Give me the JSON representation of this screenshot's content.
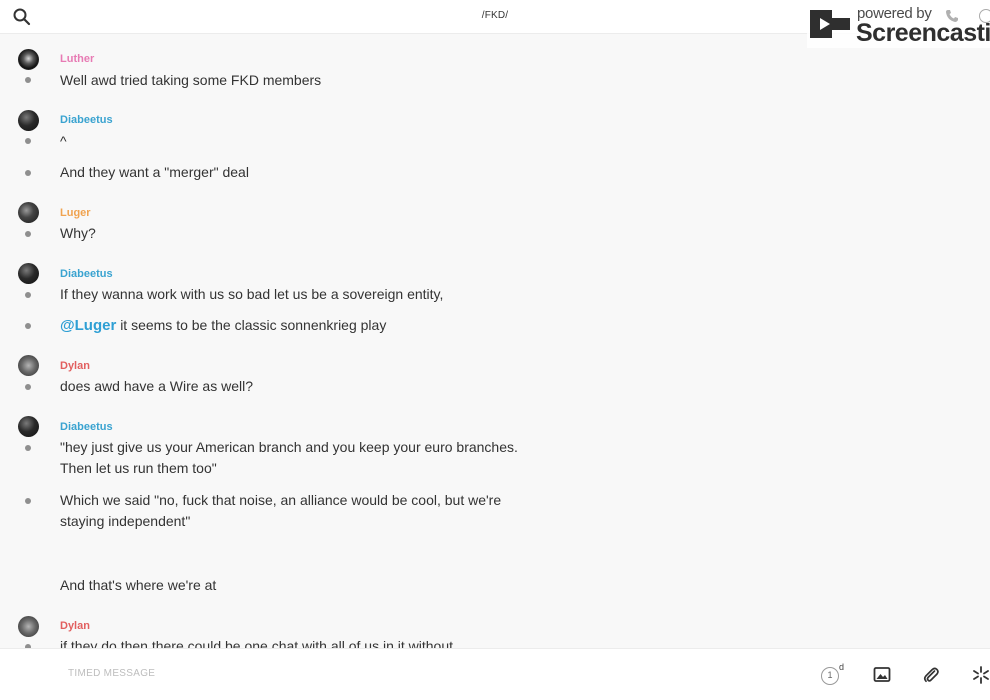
{
  "header": {
    "title": "/FKD/",
    "search_icon": "search-icon"
  },
  "watermark": {
    "powered_by": "powered by",
    "brand": "Screencastify"
  },
  "colors": {
    "luther": "#e77bb4",
    "diabeetus": "#3aa3d0",
    "luger": "#f0a350",
    "dylan": "#e25f5f",
    "mention": "#2e9fd4"
  },
  "messages": [
    {
      "sender": "Luther",
      "texts": [
        "Well awd tried taking some FKD members"
      ]
    },
    {
      "sender": "Diabeetus",
      "texts": [
        "^",
        "And they want a \"merger\" deal"
      ]
    },
    {
      "sender": "Luger",
      "texts": [
        "Why?"
      ]
    },
    {
      "sender": "Diabeetus",
      "texts": [
        "If they wanna work with us so bad let us be a sovereign entity,",
        "it seems to be the classic sonnenkrieg play"
      ],
      "mention": "@Luger"
    },
    {
      "sender": "Dylan",
      "texts": [
        "does awd have a Wire as well?"
      ]
    },
    {
      "sender": "Diabeetus",
      "texts": [
        "\"hey just give us your American branch and you keep your euro branches.",
        "Then let us run them too\"",
        "Which we said \"no, fuck that noise, an alliance would be cool, but we're",
        "staying independent\"",
        "And that's where we're at"
      ]
    },
    {
      "sender": "Dylan",
      "texts": [
        "if they do then there could be one chat with all of us in it without"
      ]
    }
  ],
  "composer": {
    "placeholder": "TIMED MESSAGE",
    "timer_value": "1",
    "timer_unit": "d"
  }
}
